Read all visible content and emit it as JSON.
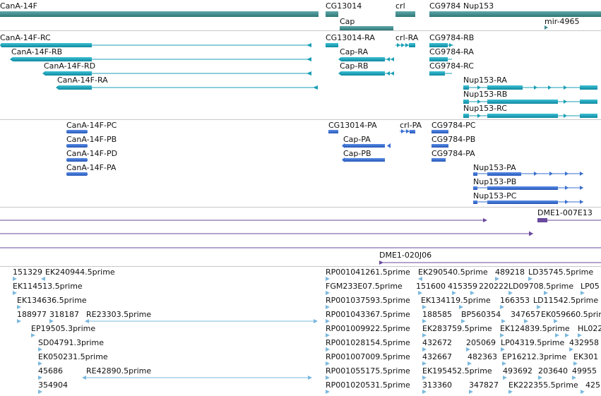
{
  "colors": {
    "gene": "#3d8b8b",
    "transcript": "#1a9fb5",
    "protein": "#3a6fd0",
    "clone": "#6a4a9e",
    "est": "#7ab8de",
    "divider": "#c8c8c8",
    "text": "#111111"
  },
  "genes": {
    "canA": "CanA-14F",
    "cg13014": "CG13014",
    "crl": "crl",
    "cg9784": "CG9784",
    "nup153": "Nup153",
    "cap": "Cap",
    "mir": "mir-4965"
  },
  "transcripts": {
    "canA_rc": "CanA-14F-RC",
    "canA_rb": "CanA-14F-RB",
    "canA_rd": "CanA-14F-RD",
    "canA_ra": "CanA-14F-RA",
    "cg13014_ra": "CG13014-RA",
    "crl_ra": "crl-RA",
    "cap_ra": "Cap-RA",
    "cap_rb": "Cap-RB",
    "cg9784_rb": "CG9784-RB",
    "cg9784_ra": "CG9784-RA",
    "cg9784_rc": "CG9784-RC",
    "nup153_ra": "Nup153-RA",
    "nup153_rb": "Nup153-RB",
    "nup153_rc": "Nup153-RC"
  },
  "proteins": {
    "canA_pc": "CanA-14F-PC",
    "canA_pb": "CanA-14F-PB",
    "canA_pd": "CanA-14F-PD",
    "canA_pa": "CanA-14F-PA",
    "cg13014_pa": "CG13014-PA",
    "crl_pa": "crl-PA",
    "cap_pa": "Cap-PA",
    "cap_pb": "Cap-PB",
    "cg9784_pc": "CG9784-PC",
    "cg9784_pb": "CG9784-PB",
    "cg9784_pa": "CG9784-PA",
    "nup153_pa": "Nup153-PA",
    "nup153_pb": "Nup153-PB",
    "nup153_pc": "Nup153-PC"
  },
  "clones": {
    "dme1_007e13": "DME1-007E13",
    "dme1_020j06": "DME1-020J06"
  },
  "ests": {
    "e151329": "151329",
    "ek240944": "EK240944.5prime",
    "ek114513": "EK114513.5prime",
    "ek134636": "EK134636.5prime",
    "e188977": "188977",
    "e318187": "318187",
    "re23303": "RE23303.5prime",
    "ep19505": "EP19505.3prime",
    "sd04791": "SD04791.3prime",
    "ek050231": "EK050231.5prime",
    "e45686": "45686",
    "re42890": "RE42890.5prime",
    "e354904": "354904",
    "rp001041261": "RP001041261.5prime",
    "fgm233e07": "FGM233E07.5prime",
    "rp001037593": "RP001037593.5prime",
    "rp001043367": "RP001043367.5prime",
    "rp001009922": "RP001009922.5prime",
    "rp001028154": "RP001028154.5prime",
    "rp001007009": "RP001007009.5prime",
    "rp001055175": "RP001055175.5prime",
    "rp001020531": "RP001020531.5prime",
    "ek290540": "EK290540.5prime",
    "e489218": "489218",
    "ld35745": "LD35745.5prime",
    "e151600": "151600",
    "e415359": "415359",
    "e220222": "220222",
    "ld09708": "LD09708.5prime",
    "lp05": "LP05",
    "ek134119": "EK134119.5prime",
    "e166353": "166353",
    "ld11542": "LD11542.5prime",
    "e188585": "188585",
    "bp560354": "BP560354",
    "e347657": "347657",
    "ek059660": "EK059660.5prime",
    "ek283759": "EK283759.5prime",
    "ek124839": "EK124839.5prime",
    "hl022": "HL022",
    "e432672": "432672",
    "e205069": "205069",
    "lp04319": "LP04319.5prime",
    "e432958": "432958",
    "e432667": "432667",
    "e482363": "482363",
    "ep16212": "EP16212.3prime",
    "ek301": "EK301",
    "ek195452": "EK195452.5prime",
    "e493692": "493692",
    "e203640": "203640",
    "e49955": "49955",
    "e313360": "313360",
    "e347827": "347827",
    "ek222355": "EK222355.5prime",
    "e425": "425"
  }
}
